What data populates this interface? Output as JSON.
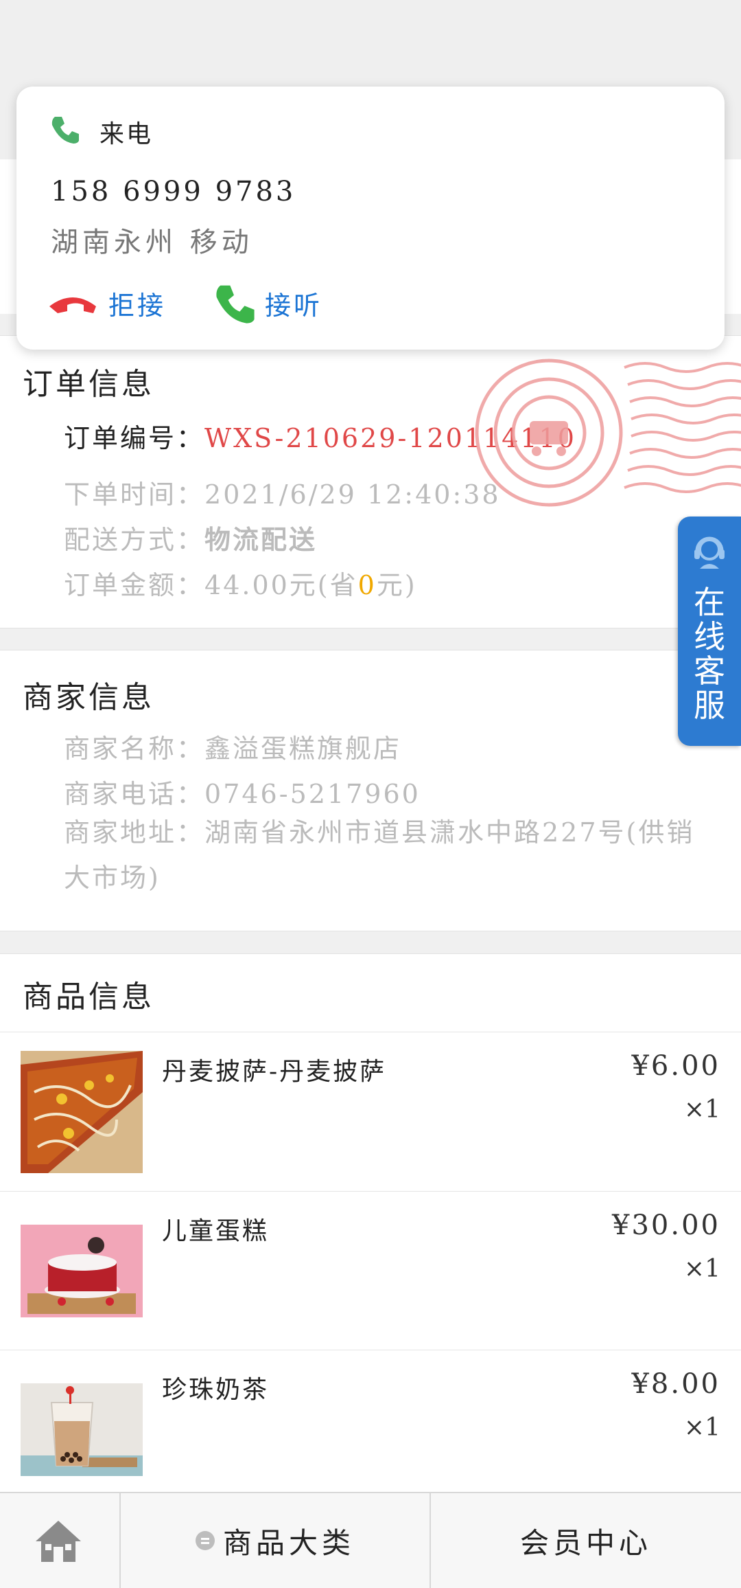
{
  "incoming_call": {
    "label": "来电",
    "number": "158 6999 9783",
    "location": "湖南永州 移动",
    "reject_label": "拒接",
    "answer_label": "接听"
  },
  "order_info": {
    "title": "订单信息",
    "order_no_label": "订单编号：",
    "order_no": "WXS-210629-120114110",
    "time_label": "下单时间：",
    "time": "2021/6/29 12:40:38",
    "delivery_label": "配送方式：",
    "delivery": "物流配送",
    "amount_label": "订单金额：",
    "amount": "44.00元(省",
    "saved": "0",
    "amount_suffix": "元)"
  },
  "customer_service": {
    "label": "在线客服"
  },
  "merchant_info": {
    "title": "商家信息",
    "name_label": "商家名称：",
    "name": "鑫溢蛋糕旗舰店",
    "phone_label": "商家电话：",
    "phone": "0746-5217960",
    "address_label": "商家地址：",
    "address": "湖南省永州市道县潇水中路227号(供销大市场)"
  },
  "goods_info": {
    "title": "商品信息",
    "items": [
      {
        "name": "丹麦披萨-丹麦披萨",
        "price": "¥6.00",
        "qty": "×1"
      },
      {
        "name": "儿童蛋糕",
        "price": "¥30.00",
        "qty": "×1"
      },
      {
        "name": "珍珠奶茶",
        "price": "¥8.00",
        "qty": "×1"
      }
    ]
  },
  "bottom_nav": {
    "home_icon": "home-icon",
    "category_label": "商品大类",
    "member_label": "会员中心"
  },
  "colors": {
    "accent_blue": "#2d7bd1",
    "order_no_red": "#e04848",
    "reject_red": "#e8383d",
    "answer_green": "#3cb54a"
  }
}
